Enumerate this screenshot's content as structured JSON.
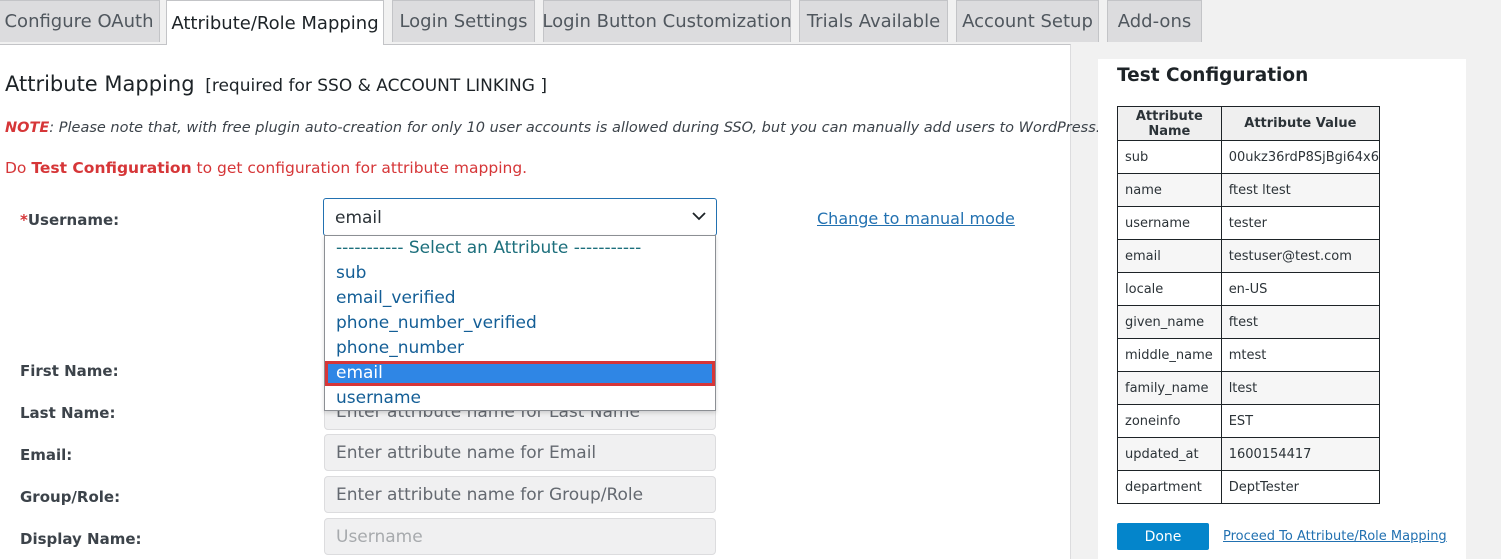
{
  "tabs": [
    {
      "label": "Configure OAuth"
    },
    {
      "label": "Attribute/Role Mapping"
    },
    {
      "label": "Login Settings"
    },
    {
      "label": "Login Button Customization"
    },
    {
      "label": "Trials Available"
    },
    {
      "label": "Account Setup"
    },
    {
      "label": "Add-ons"
    }
  ],
  "main": {
    "title": "Attribute Mapping",
    "title_sub": "[required for SSO & ACCOUNT LINKING ]",
    "note_label": "NOTE",
    "note_text": ": Please note that, with free plugin auto-creation for only 10 user accounts is allowed during SSO, but you can manually add users to WordPress.",
    "test_prefix": "Do ",
    "test_bold": "Test Configuration",
    "test_suffix": " to get configuration for attribute mapping."
  },
  "form": {
    "username_req": "*",
    "username_label": "Username:",
    "username_value": "email",
    "manual_link": "Change to manual mode",
    "dropdown_options": [
      "----------- Select an Attribute -----------",
      "sub",
      "email_verified",
      "phone_number_verified",
      "phone_number",
      "email",
      "username"
    ],
    "first_name_label": "First Name:",
    "last_name_label": "Last Name:",
    "last_name_placeholder": "Enter attribute name for Last Name",
    "email_label": "Email:",
    "email_placeholder": "Enter attribute name for Email",
    "group_label": "Group/Role:",
    "group_placeholder": "Enter attribute name for Group/Role",
    "display_label": "Display Name:",
    "display_value": "Username"
  },
  "test_config": {
    "title": "Test Configuration",
    "col_name": "Attribute Name",
    "col_value": "Attribute Value",
    "rows": [
      [
        "sub",
        "00ukz36rdP8SjBgi64x6"
      ],
      [
        "name",
        "ftest ltest"
      ],
      [
        "username",
        "tester"
      ],
      [
        "email",
        "testuser@test.com"
      ],
      [
        "locale",
        "en-US"
      ],
      [
        "given_name",
        "ftest"
      ],
      [
        "middle_name",
        "mtest"
      ],
      [
        "family_name",
        "ltest"
      ],
      [
        "zoneinfo",
        "EST"
      ],
      [
        "updated_at",
        "1600154417"
      ],
      [
        "department",
        "DeptTester"
      ]
    ],
    "done_label": "Done",
    "proceed_link": "Proceed To Attribute/Role Mapping"
  },
  "colors": {
    "accent": "#2271b1",
    "required": "#d63638",
    "selected_option": "#2f86e5",
    "done_button": "#0485cb"
  }
}
